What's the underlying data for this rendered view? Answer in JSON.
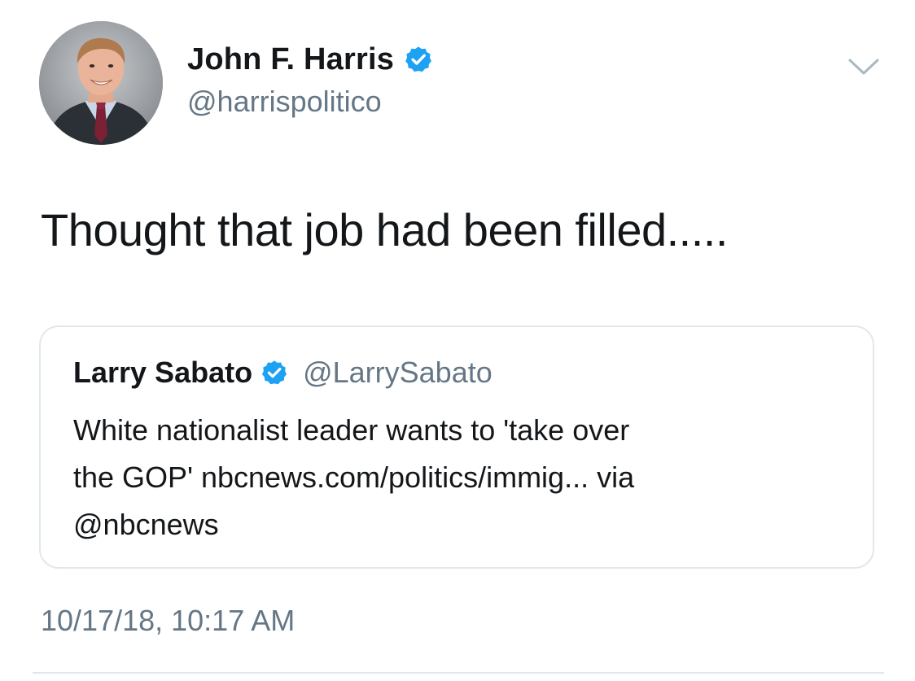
{
  "author": {
    "name": "John F. Harris",
    "handle": "@harrispolitico",
    "verified": true
  },
  "tweet": {
    "text": "Thought that job had been filled.....",
    "timestamp": "10/17/18, 10:17 AM"
  },
  "quoted_tweet": {
    "name": "Larry Sabato",
    "handle": "@LarrySabato",
    "verified": true,
    "lines": [
      "White nationalist leader wants to 'take over",
      "the GOP' nbcnews.com/politics/immig... via",
      "@nbcnews"
    ]
  },
  "icons": {
    "verified": "verified-badge-icon",
    "menu": "chevron-down-icon",
    "avatar": "profile-photo"
  },
  "colors": {
    "verified_blue": "#1da1f2",
    "secondary_text": "#657786",
    "primary_text": "#14171a",
    "border": "#e1e8ed"
  }
}
